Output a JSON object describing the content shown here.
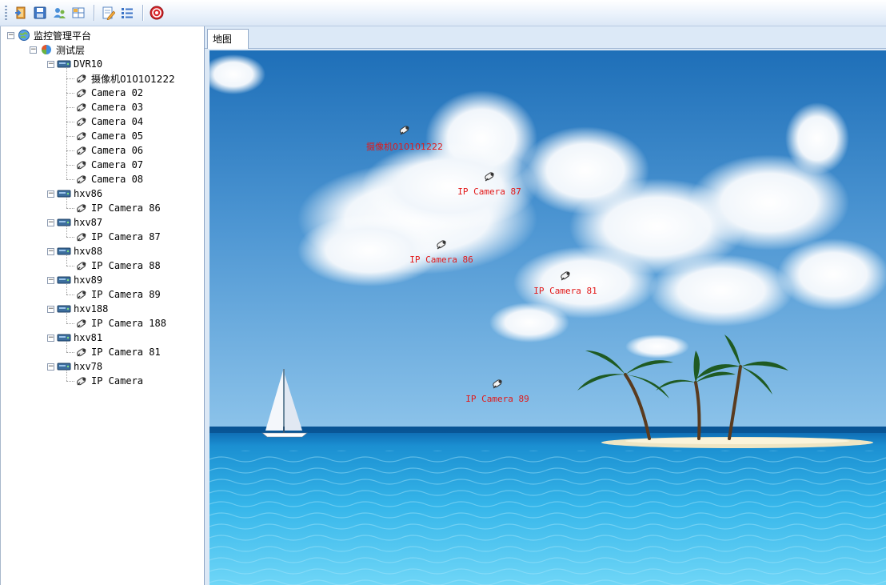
{
  "toolbar": {
    "buttons": [
      {
        "icon": "exit-door-icon"
      },
      {
        "icon": "save-disk-icon"
      },
      {
        "icon": "users-icon"
      },
      {
        "icon": "layout-icon"
      },
      {
        "icon": "edit-note-icon"
      },
      {
        "icon": "list-icon"
      },
      {
        "icon": "stop-icon"
      }
    ]
  },
  "tree": {
    "root": "监控管理平台",
    "layer": "测试层",
    "devices": [
      {
        "name": "DVR10",
        "cameras": [
          "摄像机010101222",
          "Camera 02",
          "Camera 03",
          "Camera 04",
          "Camera 05",
          "Camera 06",
          "Camera 07",
          "Camera 08"
        ]
      },
      {
        "name": "hxv86",
        "cameras": [
          "IP Camera 86"
        ]
      },
      {
        "name": "hxv87",
        "cameras": [
          "IP Camera 87"
        ]
      },
      {
        "name": "hxv88",
        "cameras": [
          "IP Camera 88"
        ]
      },
      {
        "name": "hxv89",
        "cameras": [
          "IP Camera 89"
        ]
      },
      {
        "name": "hxv188",
        "cameras": [
          "IP Camera 188"
        ]
      },
      {
        "name": "hxv81",
        "cameras": [
          "IP Camera 81"
        ]
      },
      {
        "name": "hxv78",
        "cameras": [
          "IP Camera"
        ]
      }
    ]
  },
  "tabs": [
    {
      "label": "地图"
    }
  ],
  "map": {
    "markers": [
      {
        "label": "摄像机010101222"
      },
      {
        "label": "IP Camera 87"
      },
      {
        "label": "IP Camera 86"
      },
      {
        "label": "IP Camera 81"
      },
      {
        "label": "IP Camera 89"
      }
    ]
  }
}
